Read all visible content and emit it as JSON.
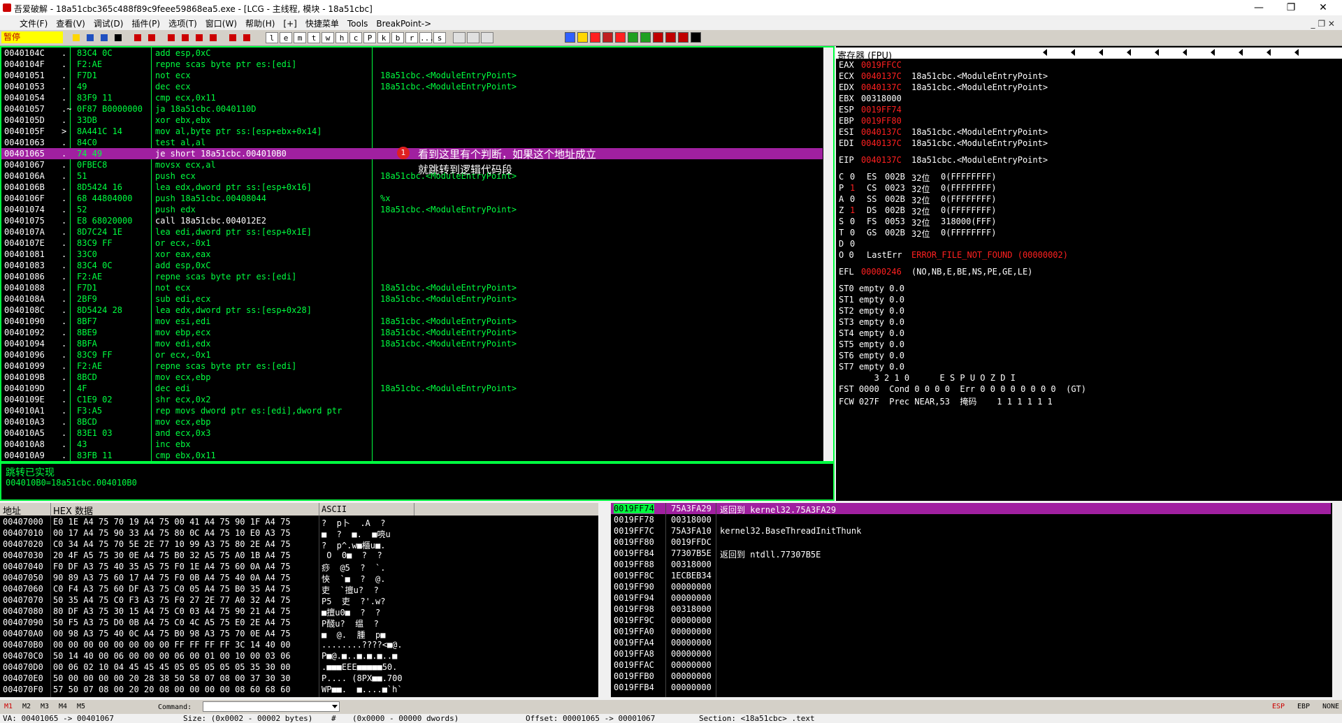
{
  "title": "吾爱破解 - 18a51cbc365c488f89c9feee59868ea5.exe - [LCG - 主线程, 模块 - 18a51cbc]",
  "window_controls": {
    "minimize": "—",
    "maximize": "❐",
    "close": "✕"
  },
  "menu": [
    "文件(F)",
    "查看(V)",
    "调试(D)",
    "插件(P)",
    "选项(T)",
    "窗口(W)",
    "帮助(H)",
    "[+]",
    "快捷菜单",
    "Tools",
    "BreakPoint->"
  ],
  "menu_mdi": "_ ❐ ✕",
  "toolbar": {
    "status": "暂停",
    "letters": [
      "l",
      "e",
      "m",
      "t",
      "w",
      "h",
      "c",
      "P",
      "k",
      "b",
      "r",
      "...",
      "s"
    ]
  },
  "cpu": {
    "rows": [
      {
        "addr": "0040104C",
        "mark": ".",
        "hex": "83C4 0C",
        "dis": "add esp,0xC",
        "com": ""
      },
      {
        "addr": "0040104F",
        "mark": ".",
        "hex": "F2:AE",
        "dis": "repne scas byte ptr es:[edi]",
        "com": ""
      },
      {
        "addr": "00401051",
        "mark": ".",
        "hex": "F7D1",
        "dis": "not ecx",
        "com": "18a51cbc.<ModuleEntryPoint>"
      },
      {
        "addr": "00401053",
        "mark": ".",
        "hex": "49",
        "dis": "dec ecx",
        "com": "18a51cbc.<ModuleEntryPoint>"
      },
      {
        "addr": "00401054",
        "mark": ".",
        "hex": "83F9 11",
        "dis": "cmp ecx,0x11",
        "com": ""
      },
      {
        "addr": "00401057",
        "mark": ".~",
        "hex": "0F87 B0000000",
        "dis": "ja 18a51cbc.0040110D",
        "com": ""
      },
      {
        "addr": "0040105D",
        "mark": ".",
        "hex": "33DB",
        "dis": "xor ebx,ebx",
        "com": ""
      },
      {
        "addr": "0040105F",
        "mark": ">",
        "hex": "8A441C 14",
        "dis": "mov al,byte ptr ss:[esp+ebx+0x14]",
        "com": ""
      },
      {
        "addr": "00401063",
        "mark": ".",
        "hex": "84C0",
        "dis": "test al,al",
        "com": ""
      },
      {
        "addr": "00401065",
        "mark": ".",
        "hex": "74 49",
        "dis": "je short 18a51cbc.004010B0",
        "com": ""
      },
      {
        "addr": "00401067",
        "mark": ".",
        "hex": "0FBEC8",
        "dis": "movsx ecx,al",
        "com": ""
      },
      {
        "addr": "0040106A",
        "mark": ".",
        "hex": "51",
        "dis": "push ecx",
        "com": "18a51cbc.<ModuleEntryPoint>"
      },
      {
        "addr": "0040106B",
        "mark": ".",
        "hex": "8D5424 16",
        "dis": "lea edx,dword ptr ss:[esp+0x16]",
        "com": ""
      },
      {
        "addr": "0040106F",
        "mark": ".",
        "hex": "68 44804000",
        "dis": "push 18a51cbc.00408044",
        "com": "%x"
      },
      {
        "addr": "00401074",
        "mark": ".",
        "hex": "52",
        "dis": "push edx",
        "com": "18a51cbc.<ModuleEntryPoint>"
      },
      {
        "addr": "00401075",
        "mark": ".",
        "hex": "E8 68020000",
        "dis": "call 18a51cbc.004012E2",
        "com": ""
      },
      {
        "addr": "0040107A",
        "mark": ".",
        "hex": "8D7C24 1E",
        "dis": "lea edi,dword ptr ss:[esp+0x1E]",
        "com": ""
      },
      {
        "addr": "0040107E",
        "mark": ".",
        "hex": "83C9 FF",
        "dis": "or ecx,-0x1",
        "com": ""
      },
      {
        "addr": "00401081",
        "mark": ".",
        "hex": "33C0",
        "dis": "xor eax,eax",
        "com": ""
      },
      {
        "addr": "00401083",
        "mark": ".",
        "hex": "83C4 0C",
        "dis": "add esp,0xC",
        "com": ""
      },
      {
        "addr": "00401086",
        "mark": ".",
        "hex": "F2:AE",
        "dis": "repne scas byte ptr es:[edi]",
        "com": ""
      },
      {
        "addr": "00401088",
        "mark": ".",
        "hex": "F7D1",
        "dis": "not ecx",
        "com": "18a51cbc.<ModuleEntryPoint>"
      },
      {
        "addr": "0040108A",
        "mark": ".",
        "hex": "2BF9",
        "dis": "sub edi,ecx",
        "com": "18a51cbc.<ModuleEntryPoint>"
      },
      {
        "addr": "0040108C",
        "mark": ".",
        "hex": "8D5424 28",
        "dis": "lea edx,dword ptr ss:[esp+0x28]",
        "com": ""
      },
      {
        "addr": "00401090",
        "mark": ".",
        "hex": "8BF7",
        "dis": "mov esi,edi",
        "com": "18a51cbc.<ModuleEntryPoint>"
      },
      {
        "addr": "00401092",
        "mark": ".",
        "hex": "8BE9",
        "dis": "mov ebp,ecx",
        "com": "18a51cbc.<ModuleEntryPoint>"
      },
      {
        "addr": "00401094",
        "mark": ".",
        "hex": "8BFA",
        "dis": "mov edi,edx",
        "com": "18a51cbc.<ModuleEntryPoint>"
      },
      {
        "addr": "00401096",
        "mark": ".",
        "hex": "83C9 FF",
        "dis": "or ecx,-0x1",
        "com": ""
      },
      {
        "addr": "00401099",
        "mark": ".",
        "hex": "F2:AE",
        "dis": "repne scas byte ptr es:[edi]",
        "com": ""
      },
      {
        "addr": "0040109B",
        "mark": ".",
        "hex": "8BCD",
        "dis": "mov ecx,ebp",
        "com": ""
      },
      {
        "addr": "0040109D",
        "mark": ".",
        "hex": "4F",
        "dis": "dec edi",
        "com": "18a51cbc.<ModuleEntryPoint>"
      },
      {
        "addr": "0040109E",
        "mark": ".",
        "hex": "C1E9 02",
        "dis": "shr ecx,0x2",
        "com": ""
      },
      {
        "addr": "004010A1",
        "mark": ".",
        "hex": "F3:A5",
        "dis": "rep movs dword ptr es:[edi],dword ptr",
        "com": ""
      },
      {
        "addr": "004010A3",
        "mark": ".",
        "hex": "8BCD",
        "dis": "mov ecx,ebp",
        "com": ""
      },
      {
        "addr": "004010A5",
        "mark": ".",
        "hex": "83E1 03",
        "dis": "and ecx,0x3",
        "com": ""
      },
      {
        "addr": "004010A8",
        "mark": ".",
        "hex": "43",
        "dis": "inc ebx",
        "com": ""
      },
      {
        "addr": "004010A9",
        "mark": ".",
        "hex": "83FB 11",
        "dis": "cmp ebx,0x11",
        "com": ""
      }
    ],
    "annotation": {
      "number": "1",
      "line1": "看到这里有个判断，如果这个地址成立",
      "line2": "就跳转到逻辑代码段"
    }
  },
  "info": {
    "line1": "跳转已实现",
    "line2": "004010B0=18a51cbc.004010B0"
  },
  "registers": {
    "header": "寄存器 (FPU)",
    "general": [
      {
        "name": "EAX",
        "value": "0019FFCC",
        "red": true,
        "comment": ""
      },
      {
        "name": "ECX",
        "value": "0040137C",
        "red": true,
        "comment": "18a51cbc.<ModuleEntryPoint>"
      },
      {
        "name": "EDX",
        "value": "0040137C",
        "red": true,
        "comment": "18a51cbc.<ModuleEntryPoint>"
      },
      {
        "name": "EBX",
        "value": "00318000",
        "red": false,
        "comment": ""
      },
      {
        "name": "ESP",
        "value": "0019FF74",
        "red": true,
        "comment": ""
      },
      {
        "name": "EBP",
        "value": "0019FF80",
        "red": true,
        "comment": ""
      },
      {
        "name": "ESI",
        "value": "0040137C",
        "red": true,
        "comment": "18a51cbc.<ModuleEntryPoint>"
      },
      {
        "name": "EDI",
        "value": "0040137C",
        "red": true,
        "comment": "18a51cbc.<ModuleEntryPoint>"
      }
    ],
    "eip": {
      "name": "EIP",
      "value": "0040137C",
      "comment": "18a51cbc.<ModuleEntryPoint>"
    },
    "flags": [
      {
        "f": "C",
        "v": "0",
        "seg": "ES",
        "sv": "002B",
        "bits": "32位",
        "desc": "0(FFFFFFFF)",
        "red": false
      },
      {
        "f": "P",
        "v": "1",
        "seg": "CS",
        "sv": "0023",
        "bits": "32位",
        "desc": "0(FFFFFFFF)",
        "red": true
      },
      {
        "f": "A",
        "v": "0",
        "seg": "SS",
        "sv": "002B",
        "bits": "32位",
        "desc": "0(FFFFFFFF)",
        "red": false
      },
      {
        "f": "Z",
        "v": "1",
        "seg": "DS",
        "sv": "002B",
        "bits": "32位",
        "desc": "0(FFFFFFFF)",
        "red": true
      },
      {
        "f": "S",
        "v": "0",
        "seg": "FS",
        "sv": "0053",
        "bits": "32位",
        "desc": "318000(FFF)",
        "red": false
      },
      {
        "f": "T",
        "v": "0",
        "seg": "GS",
        "sv": "002B",
        "bits": "32位",
        "desc": "0(FFFFFFFF)",
        "red": false
      },
      {
        "f": "D",
        "v": "0",
        "seg": "",
        "sv": "",
        "bits": "",
        "desc": "",
        "red": false
      }
    ],
    "lasterr": {
      "flag": "O 0",
      "label": "LastErr",
      "value": "ERROR_FILE_NOT_FOUND (00000002)"
    },
    "efl": {
      "label": "EFL",
      "value": "00000246",
      "desc": "(NO,NB,E,BE,NS,PE,GE,LE)"
    },
    "fpu": [
      "ST0 empty 0.0",
      "ST1 empty 0.0",
      "ST2 empty 0.0",
      "ST3 empty 0.0",
      "ST4 empty 0.0",
      "ST5 empty 0.0",
      "ST6 empty 0.0",
      "ST7 empty 0.0"
    ],
    "fpu_bits_header": "       3 2 1 0      E S P U O Z D I",
    "fst": "FST 0000  Cond 0 0 0 0  Err 0 0 0 0 0 0 0 0  (GT)",
    "fcw": "FCW 027F  Prec NEAR,53  掩码    1 1 1 1 1 1"
  },
  "dump": {
    "col_addr": "地址",
    "col_hex": "HEX 数据",
    "col_ascii": "ASCII",
    "rows": [
      {
        "addr": "00407000",
        "hex": "E0 1E A4 75 70 19 A4 75 00 41 A4 75 90 1F A4 75",
        "ascii": "?  p卜  .A  ?"
      },
      {
        "addr": "00407010",
        "hex": "00 17 A4 75 90 33 A4 75 80 0C A4 75 10 E0 A3 75",
        "ascii": "■  ?  ■.  ■喨u"
      },
      {
        "addr": "00407020",
        "hex": "C0 34 A4 75 70 5E 2E 77 10 99 A3 75 80 2E A4 75",
        "ascii": "?  p^.w■櫃u■."
      },
      {
        "addr": "00407030",
        "hex": "20 4F A5 75 30 0E A4 75 B0 32 A5 75 A0 1B A4 75",
        "ascii": " O  0■  ?  ?"
      },
      {
        "addr": "00407040",
        "hex": "F0 DF A3 75 40 35 A5 75 F0 1E A4 75 60 0A A4 75",
        "ascii": "痧  @5  ?  `."
      },
      {
        "addr": "00407050",
        "hex": "90 89 A3 75 60 17 A4 75 F0 0B A4 75 40 0A A4 75",
        "ascii": "悏  `■  ?  @."
      },
      {
        "addr": "00407060",
        "hex": "C0 F4 A3 75 60 DF A3 75 C0 05 A4 75 B0 35 A4 75",
        "ascii": "吏  `擅u?  ?"
      },
      {
        "addr": "00407070",
        "hex": "50 35 A4 75 C0 F3 A3 75 F0 27 2E 77 A0 32 A4 75",
        "ascii": "P5  吏  ?'.w?"
      },
      {
        "addr": "00407080",
        "hex": "80 DF A3 75 30 15 A4 75 C0 03 A4 75 90 21 A4 75",
        "ascii": "■擅u0■  ?  ?"
      },
      {
        "addr": "00407090",
        "hex": "50 F5 A3 75 D0 0B A4 75 C0 4C A5 75 E0 2E A4 75",
        "ascii": "P醆u?  缊  ?"
      },
      {
        "addr": "004070A0",
        "hex": "00 98 A3 75 40 0C A4 75 B0 98 A3 75 70 0E A4 75",
        "ascii": "■  @.  腫  p■"
      },
      {
        "addr": "004070B0",
        "hex": "00 00 00 00 00 00 00 00 FF FF FF FF 3C 14 40 00",
        "ascii": "........????<■@."
      },
      {
        "addr": "004070C0",
        "hex": "50 14 40 00 06 00 00 00 06 00 01 00 10 00 03 06",
        "ascii": "P■@.■..■.■.■..■"
      },
      {
        "addr": "004070D0",
        "hex": "00 06 02 10 04 45 45 45 05 05 05 05 05 35 30 00",
        "ascii": ".■■■EEE■■■■■50."
      },
      {
        "addr": "004070E0",
        "hex": "50 00 00 00 00 20 28 38 50 58 07 08 00 37 30 30",
        "ascii": "P.... (8PX■■.700"
      },
      {
        "addr": "004070F0",
        "hex": "57 50 07 08 00 20 20 08 00 00 00 00 08 60 68 60",
        "ascii": "WP■■.  ■....■`h`"
      }
    ]
  },
  "stack": {
    "rows": [
      {
        "addr": "0019FF74",
        "val": "75A3FA29",
        "com": "返回到 kernel32.75A3FA29",
        "hl": true
      },
      {
        "addr": "0019FF78",
        "val": "00318000",
        "com": "",
        "hl": false
      },
      {
        "addr": "0019FF7C",
        "val": "75A3FA10",
        "com": "kernel32.BaseThreadInitThunk",
        "hl": false
      },
      {
        "addr": "0019FF80",
        "val": "0019FFDC",
        "com": "",
        "hl": false
      },
      {
        "addr": "0019FF84",
        "val": "77307B5E",
        "com": "返回到 ntdll.77307B5E",
        "hl": false
      },
      {
        "addr": "0019FF88",
        "val": "00318000",
        "com": "",
        "hl": false
      },
      {
        "addr": "0019FF8C",
        "val": "1ECBEB34",
        "com": "",
        "hl": false
      },
      {
        "addr": "0019FF90",
        "val": "00000000",
        "com": "",
        "hl": false
      },
      {
        "addr": "0019FF94",
        "val": "00000000",
        "com": "",
        "hl": false
      },
      {
        "addr": "0019FF98",
        "val": "00318000",
        "com": "",
        "hl": false
      },
      {
        "addr": "0019FF9C",
        "val": "00000000",
        "com": "",
        "hl": false
      },
      {
        "addr": "0019FFA0",
        "val": "00000000",
        "com": "",
        "hl": false
      },
      {
        "addr": "0019FFA4",
        "val": "00000000",
        "com": "",
        "hl": false
      },
      {
        "addr": "0019FFA8",
        "val": "00000000",
        "com": "",
        "hl": false
      },
      {
        "addr": "0019FFAC",
        "val": "00000000",
        "com": "",
        "hl": false
      },
      {
        "addr": "0019FFB0",
        "val": "00000000",
        "com": "",
        "hl": false
      },
      {
        "addr": "0019FFB4",
        "val": "00000000",
        "com": "",
        "hl": false
      }
    ]
  },
  "cmdbar": {
    "marks": [
      "M1",
      "M2",
      "M3",
      "M4",
      "M5"
    ],
    "label": "Command:",
    "right": [
      "ESP",
      "EBP",
      "NONE"
    ]
  },
  "statusbar": {
    "va": "VA: 00401065 -> 00401067",
    "size": "Size: (0x0002 - 00002 bytes)",
    "hash": "#",
    "dwords": "(0x0000 - 00000 dwords)",
    "offset": "Offset: 00001065 -> 00001067",
    "section": "Section: <18a51cbc> .text"
  },
  "colors": {
    "green": "#00ff40",
    "highlight": "#a020a0",
    "red": "#ff2020",
    "pause_bg": "#ffff00"
  }
}
